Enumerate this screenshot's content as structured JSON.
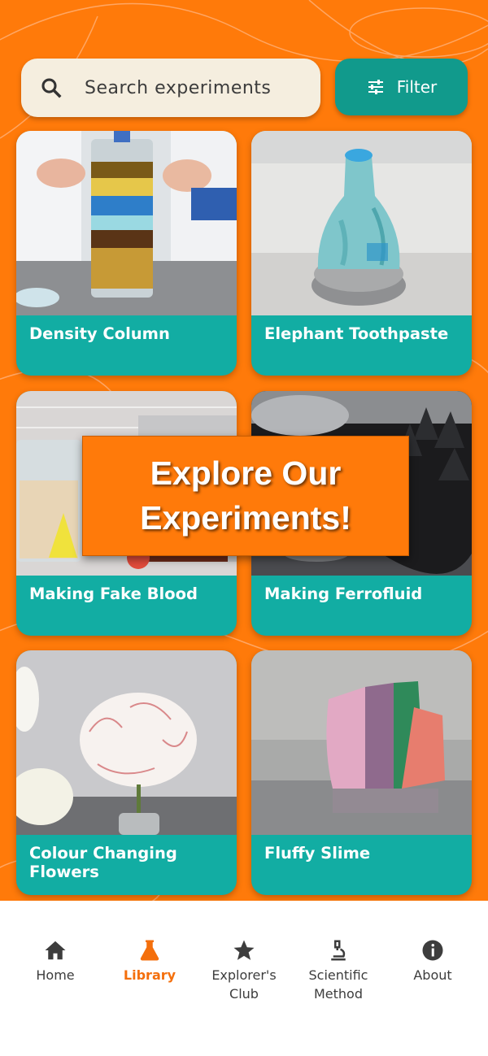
{
  "search": {
    "placeholder": "Search experiments",
    "icon": "search-icon"
  },
  "filter": {
    "label": "Filter",
    "icon": "tune-icon"
  },
  "cards": [
    {
      "title": "Density Column"
    },
    {
      "title": "Elephant Toothpaste"
    },
    {
      "title": "Making Fake Blood"
    },
    {
      "title": "Making Ferrofluid"
    },
    {
      "title": "Colour Changing Flowers"
    },
    {
      "title": "Fluffy Slime"
    }
  ],
  "banner": {
    "line1": "Explore Our",
    "line2": "Experiments!"
  },
  "tabs": [
    {
      "label": "Home",
      "icon": "home-icon",
      "active": false
    },
    {
      "label": "Library",
      "icon": "flask-icon",
      "active": true
    },
    {
      "label": "Explorer's Club",
      "icon": "star-icon",
      "active": false
    },
    {
      "label": "Scientific Method",
      "icon": "microscope-icon",
      "active": false
    },
    {
      "label": "About",
      "icon": "info-icon",
      "active": false
    }
  ],
  "colors": {
    "background": "#ff7a0a",
    "card": "#12ada3",
    "filter": "#119a8c",
    "active_tab": "#f46f0c"
  }
}
